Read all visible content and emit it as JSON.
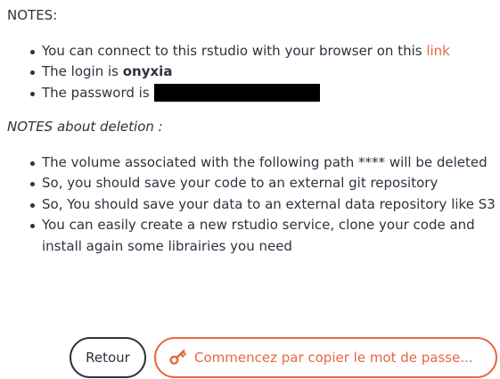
{
  "notes": {
    "heading": "NOTES:",
    "items": {
      "connect_prefix": "You can connect to this rstudio with your browser on this ",
      "connect_link": "link",
      "login_prefix": "The login is ",
      "login_value": "onyxia",
      "password_prefix": "The password is "
    }
  },
  "deletion_notes": {
    "heading": "NOTES about deletion :",
    "items": [
      "The volume associated with the following path **** will be deleted",
      "So, you should save your code to an external git repository",
      "So, You should save your data to an external data repository like S3",
      "You can easily create a new rstudio service, clone your code and install again some librairies you need"
    ]
  },
  "actions": {
    "back_label": "Retour",
    "copy_label": "Commencez par copier le mot de passe..."
  },
  "colors": {
    "accent": "#e5683d",
    "text": "#2c323f"
  },
  "icons": {
    "copy_button_icon": "key-icon"
  }
}
